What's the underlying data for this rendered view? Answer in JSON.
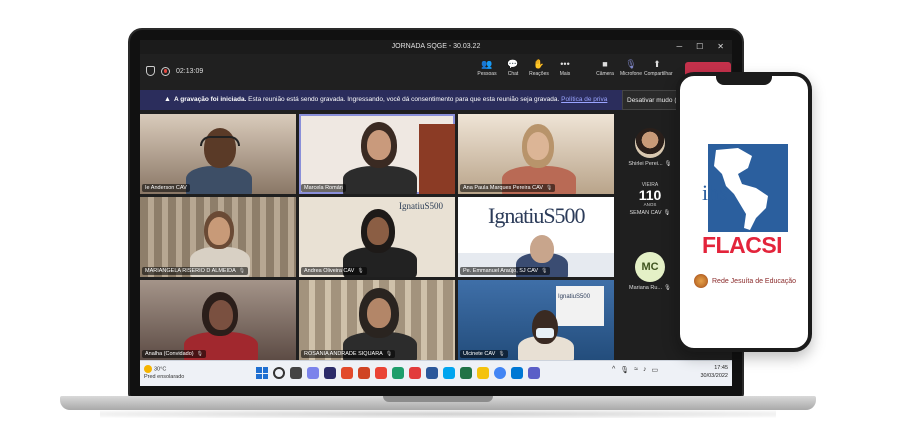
{
  "window": {
    "title": "JORNADA SQGE - 30.03.22",
    "minimize": "─",
    "maximize": "☐",
    "close": "✕"
  },
  "toolbar": {
    "timer": "02:13:09",
    "buttons": [
      {
        "label": "Pessoas",
        "icon": "people-icon"
      },
      {
        "label": "Chat",
        "icon": "chat-icon"
      },
      {
        "label": "Reações",
        "icon": "reactions-icon"
      },
      {
        "label": "Mais",
        "icon": "more-icon"
      },
      {
        "label": "Câmera",
        "icon": "camera-icon"
      },
      {
        "label": "Microfone",
        "icon": "mic-off-icon"
      },
      {
        "label": "Compartilhar",
        "icon": "share-icon"
      }
    ],
    "leave_color": "#c4314b"
  },
  "banner": {
    "bold": "A gravação foi iniciada.",
    "text": " Esta reunião está sendo gravada. Ingressando, você dá consentimento para que esta reunião seja gravada. ",
    "link": "Política de priva"
  },
  "tooltip": "Desativar mudo (",
  "participants": [
    {
      "name": "Ie Anderson CAV"
    },
    {
      "name": "Marcela Román"
    },
    {
      "name": "Ana Paula Marques Pereira CAV"
    },
    {
      "name": "MARIANGELA RISERIO D ALMEIDA"
    },
    {
      "name": "Andrea Oliveira CAV"
    },
    {
      "name": "Pe. Emmanuel Araújo, SJ CAV"
    },
    {
      "name": "Analha (Convidado)"
    },
    {
      "name": "ROSANIA ANDRADE SIQUARA"
    },
    {
      "name": "Ulcinete CAV"
    }
  ],
  "backgrounds": {
    "ignatius": "IgnatiuS500",
    "ignatius_small": "IgnatiuS500",
    "vieira_number": "110",
    "vieira_top": "VIEIRA",
    "vieira_bottom": "ANOS"
  },
  "side_participants": [
    {
      "name": "Shirlei Perei..."
    },
    {
      "name": "SEMAN CAV"
    },
    {
      "name": "Mariana Ru...",
      "initials": "MC"
    }
  ],
  "taskbar": {
    "weather_temp": "30°C",
    "weather_text": "Pred ensolarado",
    "time": "17:45",
    "date": "30/03/2022"
  },
  "phone": {
    "logo_top": "ihs",
    "logo_bottom": "FLACSI",
    "network": "Rede Jesuíta de Educação"
  }
}
